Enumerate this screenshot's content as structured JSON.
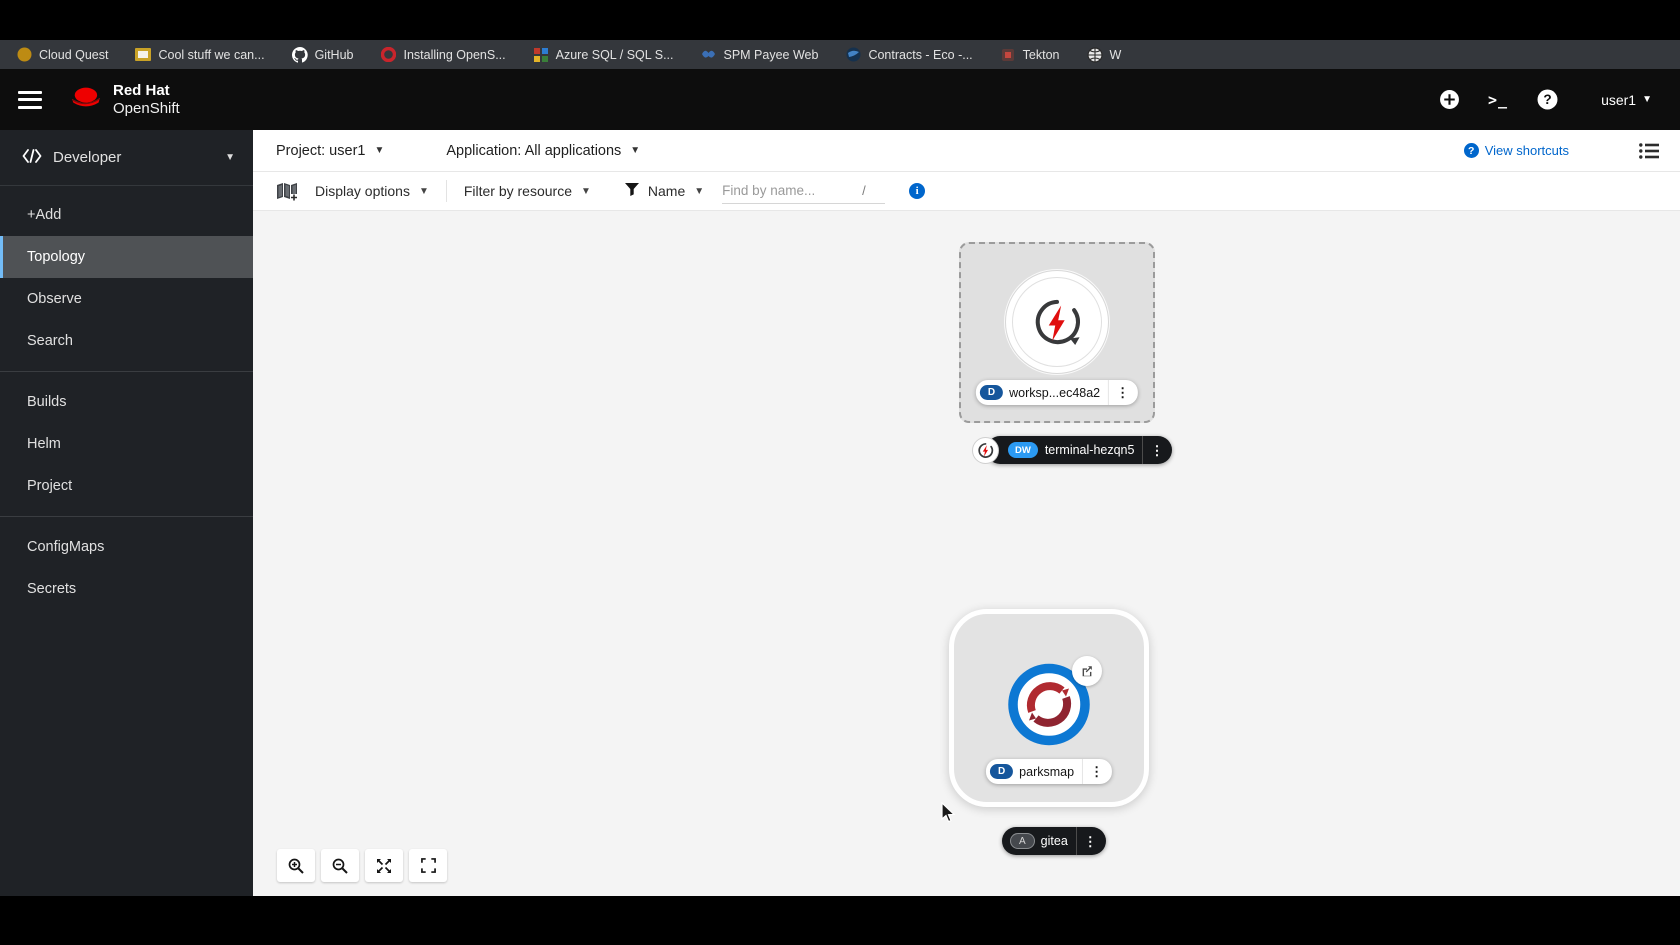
{
  "colors": {
    "accent_blue": "#0066cc",
    "openshift_red": "#ee0000",
    "badge_deployment": "#15569c",
    "badge_devworkspace": "#2b9af3",
    "sidebar_active_border": "#73bcf7"
  },
  "bookmarks_bar": {
    "items": [
      {
        "label": "Cloud Quest",
        "icon": "gold-circle-icon"
      },
      {
        "label": "Cool stuff we can...",
        "icon": "slides-icon"
      },
      {
        "label": "GitHub",
        "icon": "github-icon"
      },
      {
        "label": "Installing OpenS...",
        "icon": "openshift-ring-icon"
      },
      {
        "label": "Azure SQL / SQL S...",
        "icon": "color-grid-icon"
      },
      {
        "label": "SPM Payee Web",
        "icon": "blue-app-icon"
      },
      {
        "label": "Contracts - Eco -...",
        "icon": "dark-globe-icon"
      },
      {
        "label": "Tekton",
        "icon": "tekton-icon"
      },
      {
        "label": "W",
        "icon": "globe-icon"
      }
    ]
  },
  "header": {
    "brand_line1": "Red Hat",
    "brand_line2": "OpenShift",
    "user": "user1"
  },
  "sidebar": {
    "perspective": "Developer",
    "active_item": "Topology",
    "items": [
      {
        "label": "+Add"
      },
      {
        "label": "Topology"
      },
      {
        "label": "Observe"
      },
      {
        "label": "Search"
      },
      {
        "label": "Builds"
      },
      {
        "label": "Helm"
      },
      {
        "label": "Project"
      },
      {
        "label": "ConfigMaps"
      },
      {
        "label": "Secrets"
      }
    ]
  },
  "context_bar": {
    "project": "Project: user1",
    "application": "Application: All applications",
    "view_shortcuts": "View shortcuts"
  },
  "filter_bar": {
    "display_options": "Display options",
    "filter_by_resource": "Filter by resource",
    "name_filter": "Name",
    "find_placeholder": "Find by name...",
    "shortcut_hint": "/"
  },
  "topology": {
    "workspace_node": {
      "badge": "D",
      "label": "worksp...ec48a2"
    },
    "terminal_node": {
      "badge": "DW",
      "label": "terminal-hezqn5"
    },
    "parksmap_node": {
      "badge": "D",
      "label": "parksmap"
    },
    "gitea_group": {
      "badge": "A",
      "label": "gitea"
    }
  }
}
